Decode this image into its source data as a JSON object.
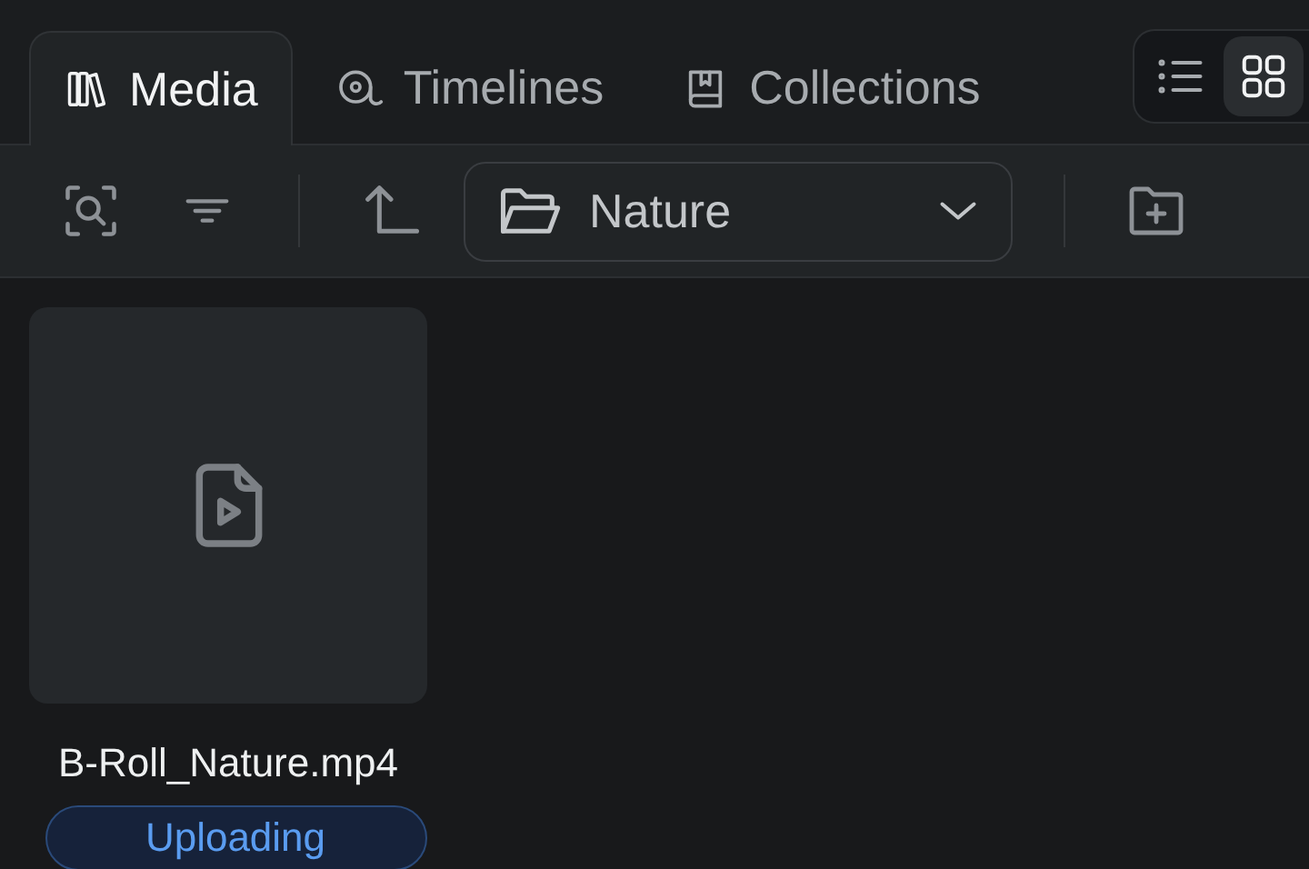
{
  "tabs": [
    {
      "label": "Media",
      "selected": true
    },
    {
      "label": "Timelines",
      "selected": false
    },
    {
      "label": "Collections",
      "selected": false
    }
  ],
  "view_toggle": [
    {
      "selected": false
    },
    {
      "selected": true
    }
  ],
  "toolbar": {
    "folder": {
      "value": "Nature"
    }
  },
  "files": [
    {
      "name": "B-Roll_Nature.mp4",
      "status": "Uploading"
    }
  ]
}
